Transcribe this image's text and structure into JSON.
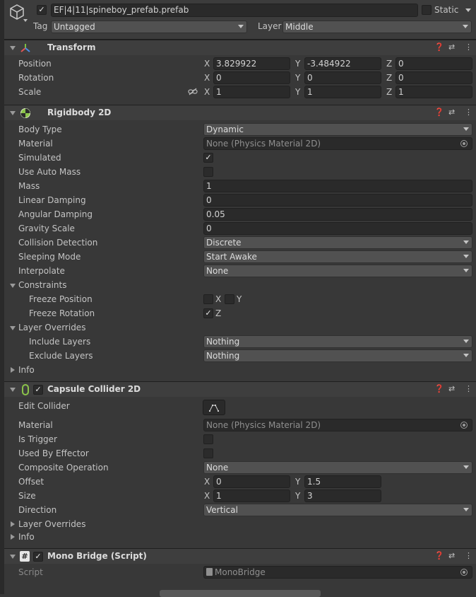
{
  "header": {
    "object_name": "EF|4|11|spineboy_prefab.prefab",
    "static_label": "Static",
    "tag_label": "Tag",
    "tag_value": "Untagged",
    "layer_label": "Layer",
    "layer_value": "Middle"
  },
  "transform": {
    "title": "Transform",
    "position_label": "Position",
    "rotation_label": "Rotation",
    "scale_label": "Scale",
    "position": {
      "x": "3.829922",
      "y": "-3.484922",
      "z": "0"
    },
    "rotation": {
      "x": "0",
      "y": "0",
      "z": "0"
    },
    "scale": {
      "x": "1",
      "y": "1",
      "z": "1"
    },
    "axis": {
      "x": "X",
      "y": "Y",
      "z": "Z"
    }
  },
  "rigidbody": {
    "title": "Rigidbody 2D",
    "body_type_label": "Body Type",
    "body_type": "Dynamic",
    "material_label": "Material",
    "material": "None (Physics Material 2D)",
    "simulated_label": "Simulated",
    "use_auto_mass_label": "Use Auto Mass",
    "mass_label": "Mass",
    "mass": "1",
    "linear_damping_label": "Linear Damping",
    "linear_damping": "0",
    "angular_damping_label": "Angular Damping",
    "angular_damping": "0.05",
    "gravity_scale_label": "Gravity Scale",
    "gravity_scale": "0",
    "collision_detection_label": "Collision Detection",
    "collision_detection": "Discrete",
    "sleeping_mode_label": "Sleeping Mode",
    "sleeping_mode": "Start Awake",
    "interpolate_label": "Interpolate",
    "interpolate": "None",
    "constraints_label": "Constraints",
    "freeze_position_label": "Freeze Position",
    "freeze_rotation_label": "Freeze Rotation",
    "axis_x": "X",
    "axis_y": "Y",
    "axis_z": "Z",
    "layer_overrides_label": "Layer Overrides",
    "include_layers_label": "Include Layers",
    "include_layers": "Nothing",
    "exclude_layers_label": "Exclude Layers",
    "exclude_layers": "Nothing",
    "info_label": "Info"
  },
  "capsule": {
    "title": "Capsule Collider 2D",
    "edit_collider_label": "Edit Collider",
    "material_label": "Material",
    "material": "None (Physics Material 2D)",
    "is_trigger_label": "Is Trigger",
    "used_by_effector_label": "Used By Effector",
    "composite_operation_label": "Composite Operation",
    "composite_operation": "None",
    "offset_label": "Offset",
    "offset": {
      "x": "0",
      "y": "1.5"
    },
    "size_label": "Size",
    "size": {
      "x": "1",
      "y": "3"
    },
    "axis_x": "X",
    "axis_y": "Y",
    "direction_label": "Direction",
    "direction": "Vertical",
    "layer_overrides_label": "Layer Overrides",
    "info_label": "Info"
  },
  "mono": {
    "title": "Mono Bridge (Script)",
    "script_label": "Script",
    "script_value": "MonoBridge"
  },
  "checks": {
    "check": "✓"
  },
  "colors": {
    "background": "#383838",
    "field": "#2a2a2a",
    "accent_green": "#8bc34a"
  }
}
